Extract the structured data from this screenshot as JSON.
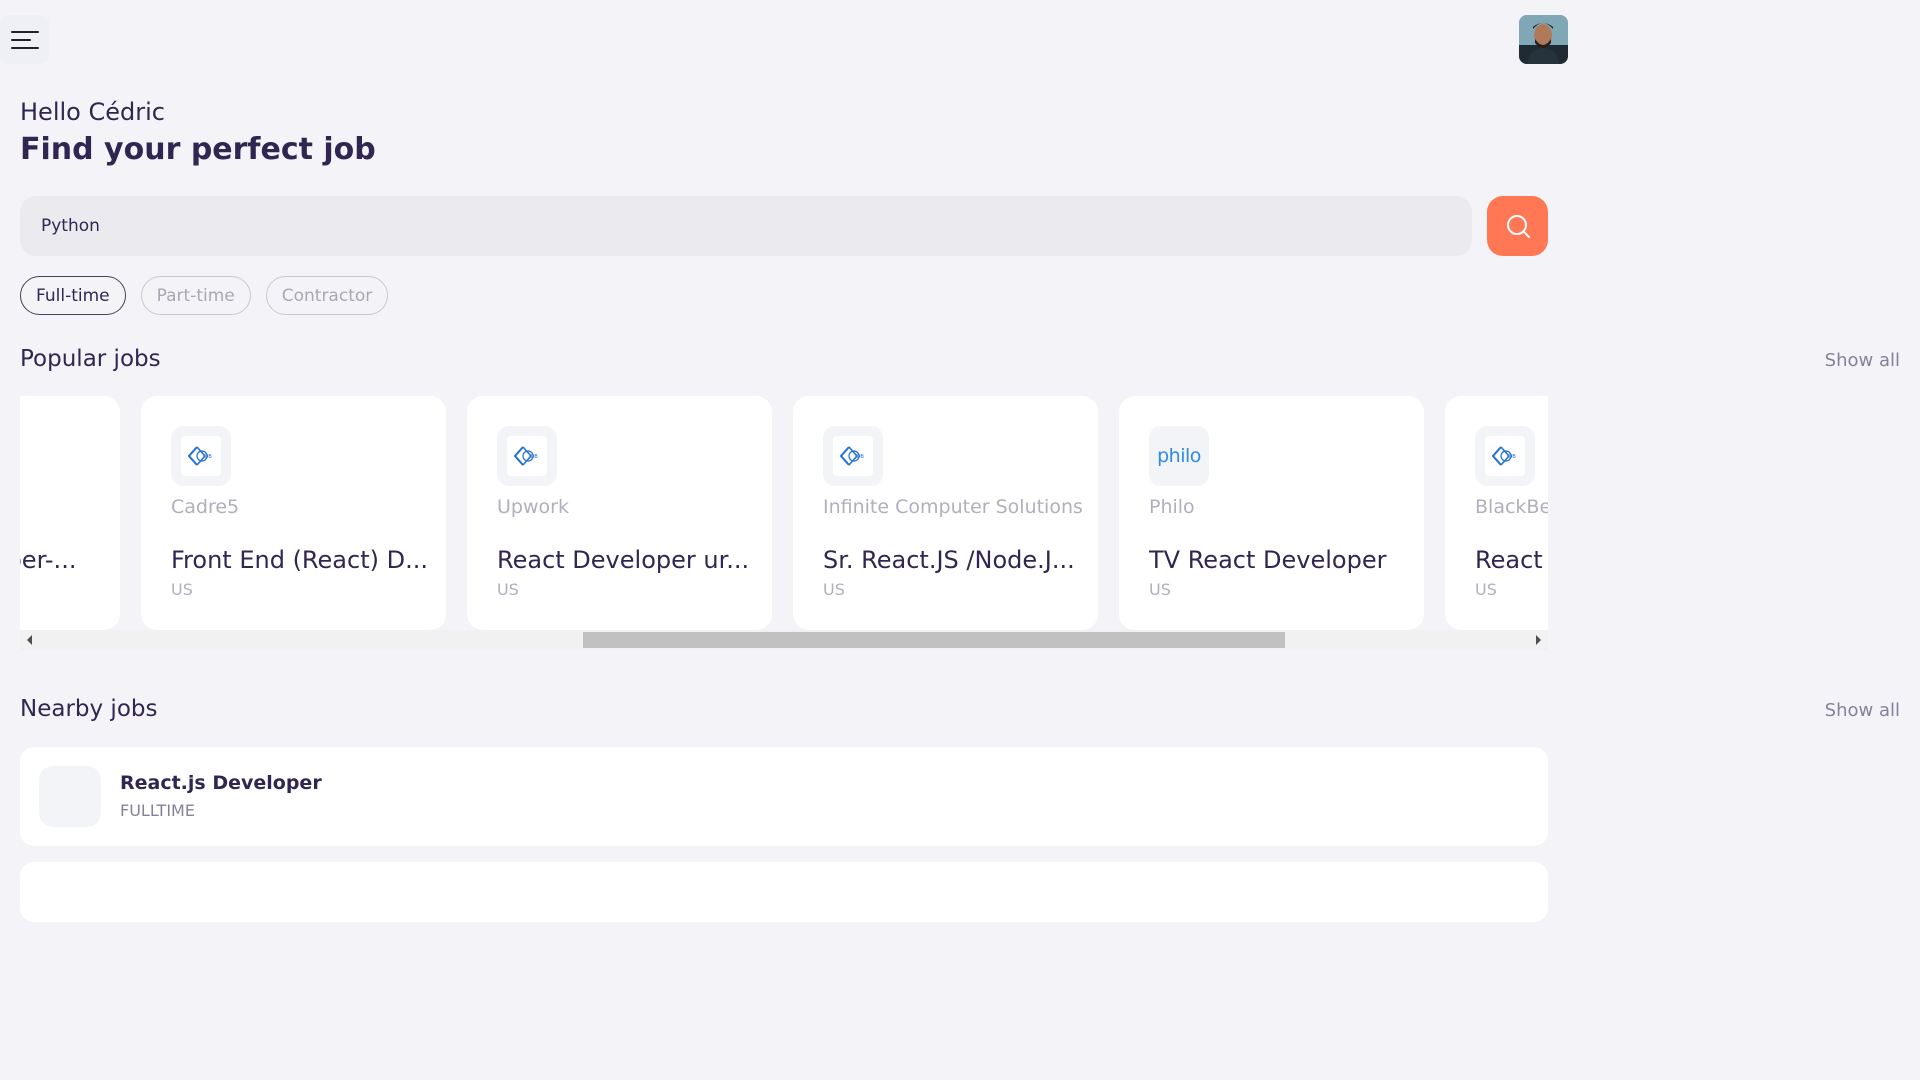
{
  "header": {
    "menu_icon": "hamburger-menu-icon",
    "avatar": "profile-avatar"
  },
  "welcome": {
    "greeting": "Hello Cédric",
    "headline": "Find your perfect job"
  },
  "search": {
    "value": "Python",
    "button_icon": "search-icon"
  },
  "filters": [
    {
      "label": "Full-time",
      "active": true
    },
    {
      "label": "Part-time",
      "active": false
    },
    {
      "label": "Contractor",
      "active": false
    }
  ],
  "popular": {
    "title": "Popular jobs",
    "show_all": "Show all",
    "cards": [
      {
        "company": "",
        "title": "Developer-...",
        "country": "",
        "logo": "job-logo-icon"
      },
      {
        "company": "Cadre5",
        "title": "Front End (React) D...",
        "country": "US",
        "logo": "job-logo-icon"
      },
      {
        "company": "Upwork",
        "title": "React Developer ur...",
        "country": "US",
        "logo": "job-logo-icon"
      },
      {
        "company": "Infinite Computer Solutions",
        "title": "Sr. React.JS /Node.J...",
        "country": "US",
        "logo": "job-logo-icon"
      },
      {
        "company": "Philo",
        "title": "TV React Developer",
        "country": "US",
        "logo": "philo",
        "logo_text": "philo"
      },
      {
        "company": "BlackBear",
        "title": "React Developer",
        "country": "US",
        "logo": "job-logo-icon"
      }
    ]
  },
  "nearby": {
    "title": "Nearby jobs",
    "show_all": "Show all",
    "items": [
      {
        "title": "React.js Developer",
        "type": "FULLTIME"
      }
    ]
  },
  "colors": {
    "accent": "#ff7754",
    "primary_text": "#312651",
    "muted_text": "#b3aebd",
    "background": "#f4f4f8"
  }
}
